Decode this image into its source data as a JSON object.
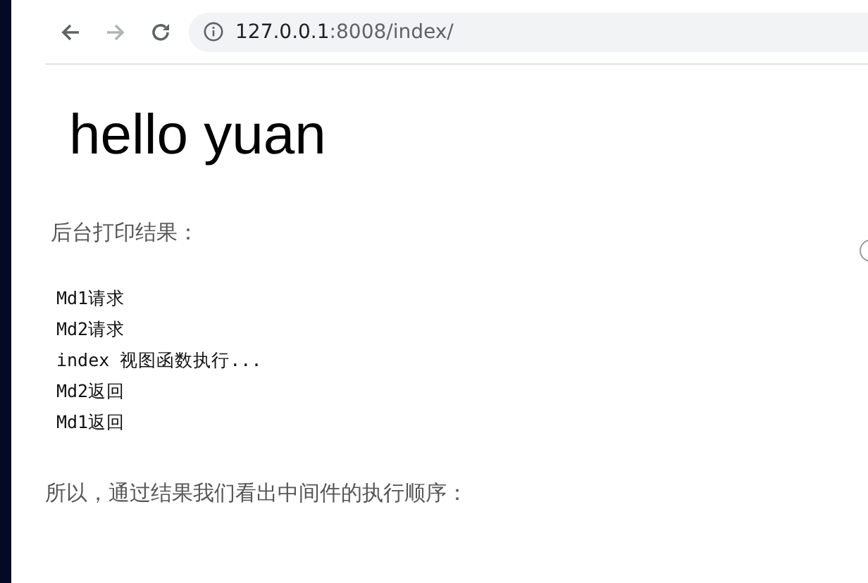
{
  "toolbar": {
    "url_host": "127.0.0.1",
    "url_path": ":8008/index/",
    "forward_disabled": true
  },
  "page": {
    "heading": "hello yuan",
    "intro": "后台打印结果：",
    "output_lines": [
      "Md1请求",
      "Md2请求",
      "index 视图函数执行...",
      "Md2返回",
      "Md1返回"
    ],
    "conclusion": "所以，通过结果我们看出中间件的执行顺序："
  }
}
